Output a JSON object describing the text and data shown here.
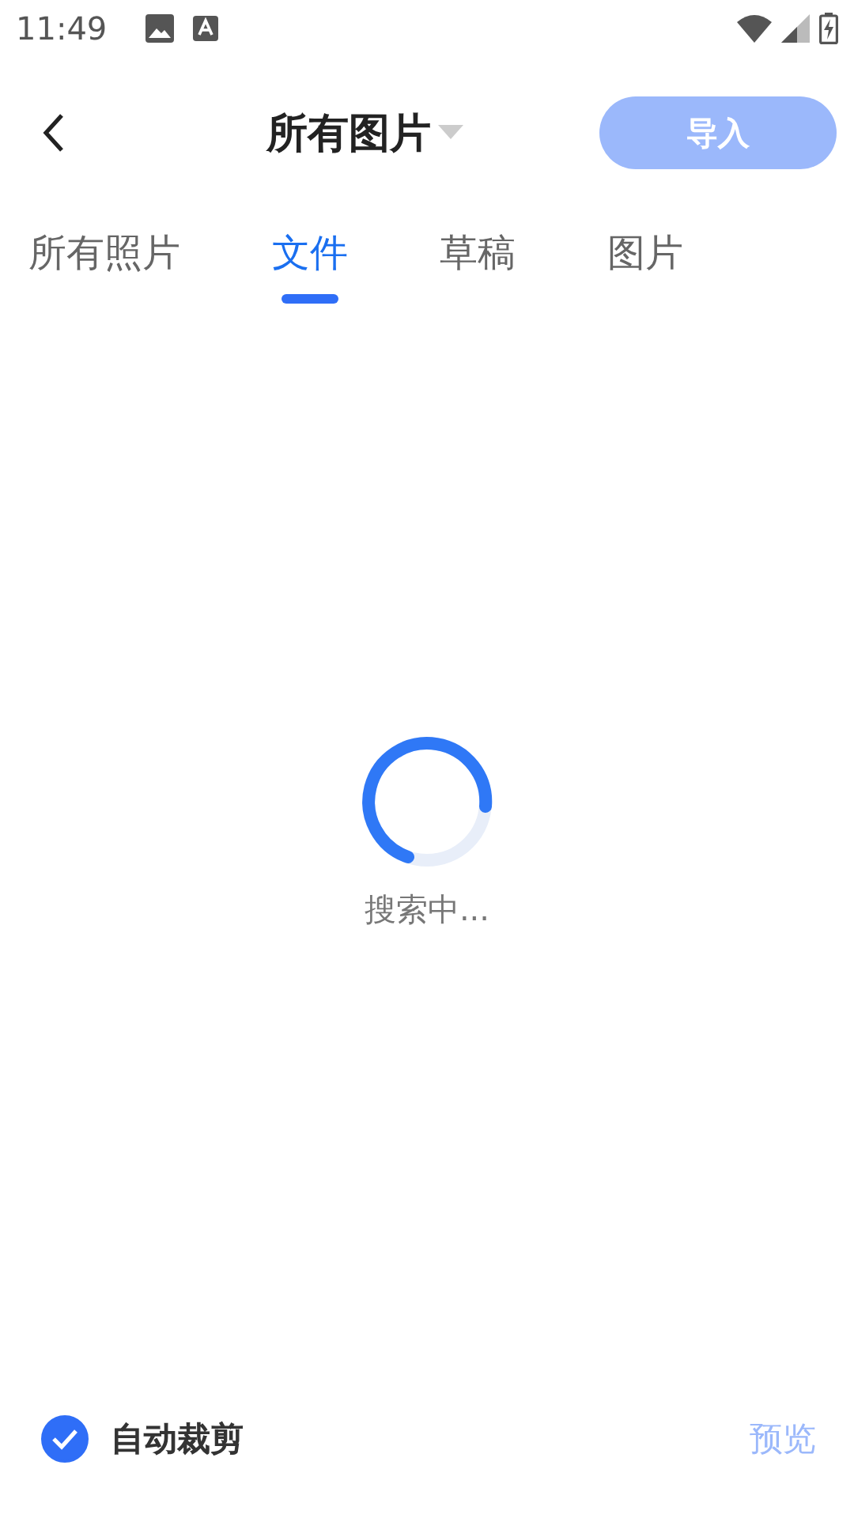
{
  "status_bar": {
    "time": "11:49"
  },
  "header": {
    "title": "所有图片",
    "import_button": {
      "label": "导入",
      "disabled": true
    }
  },
  "tabs": [
    {
      "label": "所有照片",
      "selected": false
    },
    {
      "label": "文件",
      "selected": true
    },
    {
      "label": "草稿",
      "selected": false
    },
    {
      "label": "图片",
      "selected": false
    }
  ],
  "loading": {
    "text": "搜索中..."
  },
  "footer": {
    "auto_crop": {
      "label": "自动裁剪",
      "checked": true
    },
    "preview_button": {
      "label": "预览",
      "disabled": true
    }
  }
}
